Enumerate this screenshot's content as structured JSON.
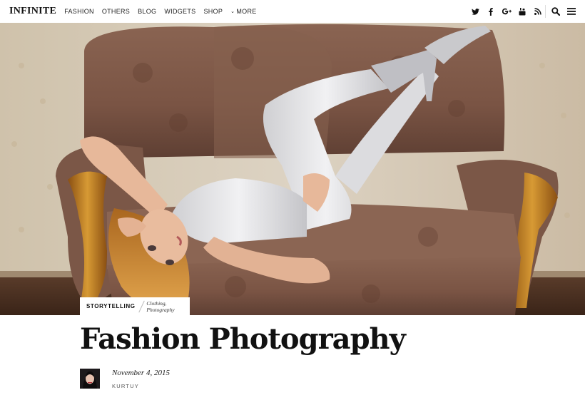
{
  "header": {
    "logo": "INFINITE",
    "nav": [
      {
        "label": "FASHION"
      },
      {
        "label": "OTHERS"
      },
      {
        "label": "BLOG"
      },
      {
        "label": "WIDGETS"
      },
      {
        "label": "SHOP"
      },
      {
        "label": "MORE",
        "icon": "chevron-down-icon"
      }
    ],
    "social_icons": [
      "twitter-icon",
      "facebook-icon",
      "google-plus-icon",
      "youtube-icon",
      "rss-icon"
    ],
    "tools": [
      "search-icon",
      "menu-icon"
    ]
  },
  "hero": {
    "image": "woman-lying-on-vintage-sofa-photo"
  },
  "post": {
    "category": "STORYTELLING",
    "tags": "Clothing, Photography",
    "title": "Fashion Photography",
    "date": "November 4, 2015",
    "author": "KURTUY"
  },
  "colors": {
    "text": "#111111",
    "header_bg": "#ffffff",
    "sofa": "#7a5544",
    "wood": "#c98a28",
    "wall": "#d8cdbc"
  }
}
